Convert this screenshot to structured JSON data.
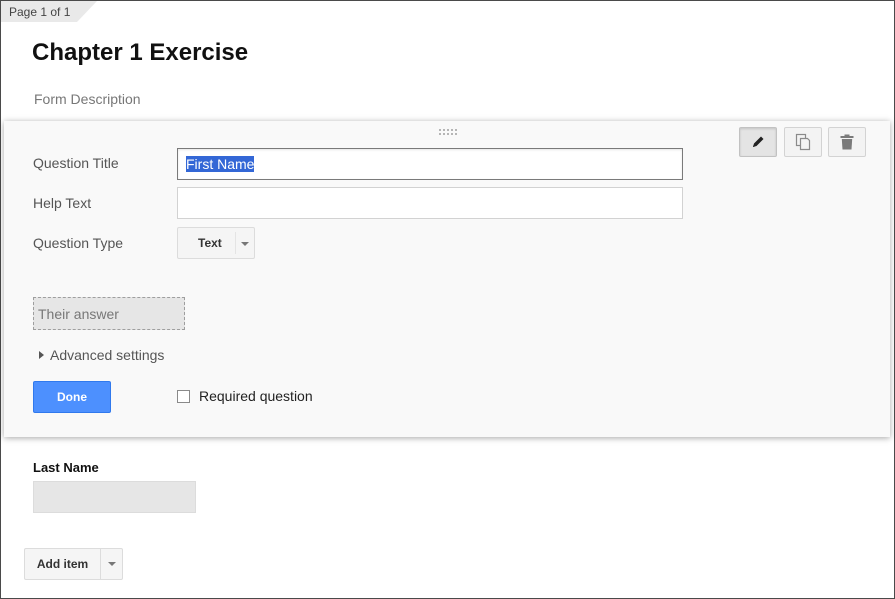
{
  "page_indicator": "Page 1 of 1",
  "form": {
    "title": "Chapter 1 Exercise",
    "description_placeholder": "Form Description"
  },
  "question_editor": {
    "question_title_label": "Question Title",
    "question_title_value": "First Name",
    "help_text_label": "Help Text",
    "help_text_value": "",
    "question_type_label": "Question Type",
    "question_type_selected": "Text",
    "answer_preview": "Their answer",
    "advanced_settings": "Advanced settings",
    "done_label": "Done",
    "required_label": "Required question",
    "required_checked": false,
    "toolbar": {
      "edit_icon": "pencil-icon",
      "duplicate_icon": "duplicate-icon",
      "delete_icon": "trash-icon"
    }
  },
  "next_question": {
    "title": "Last Name"
  },
  "add_item": {
    "label": "Add item"
  },
  "colors": {
    "accent": "#4d90fe",
    "selection": "#3367d6"
  }
}
